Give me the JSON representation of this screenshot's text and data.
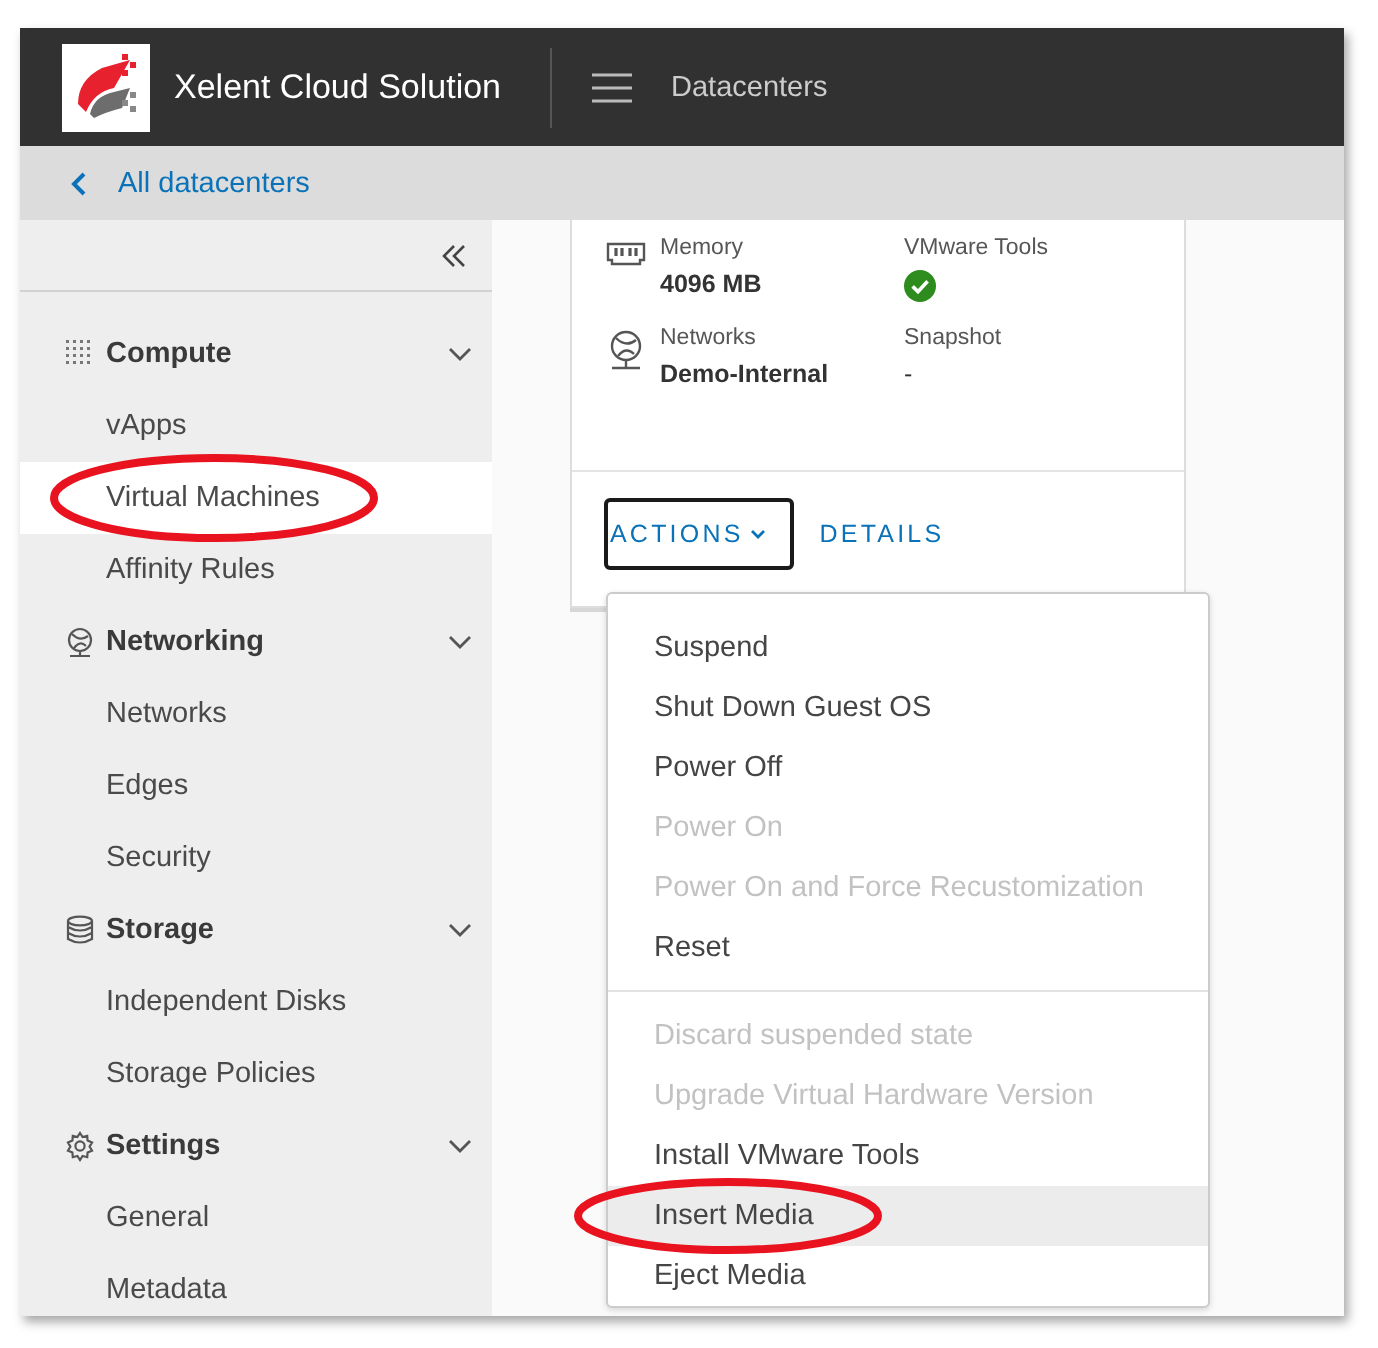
{
  "header": {
    "title": "Xelent Cloud Solution",
    "section": "Datacenters"
  },
  "breadcrumb": {
    "label": "All datacenters"
  },
  "sidebar": {
    "groups": [
      {
        "label": "Compute",
        "expanded": true,
        "items": [
          {
            "label": "vApps",
            "selected": false,
            "circled": false
          },
          {
            "label": "Virtual Machines",
            "selected": true,
            "circled": true
          },
          {
            "label": "Affinity Rules",
            "selected": false,
            "circled": false
          }
        ]
      },
      {
        "label": "Networking",
        "expanded": true,
        "items": [
          {
            "label": "Networks",
            "selected": false,
            "circled": false
          },
          {
            "label": "Edges",
            "selected": false,
            "circled": false
          },
          {
            "label": "Security",
            "selected": false,
            "circled": false
          }
        ]
      },
      {
        "label": "Storage",
        "expanded": true,
        "items": [
          {
            "label": "Independent Disks",
            "selected": false,
            "circled": false
          },
          {
            "label": "Storage Policies",
            "selected": false,
            "circled": false
          }
        ]
      },
      {
        "label": "Settings",
        "expanded": true,
        "items": [
          {
            "label": "General",
            "selected": false,
            "circled": false
          },
          {
            "label": "Metadata",
            "selected": false,
            "circled": false
          }
        ]
      }
    ]
  },
  "vm_card": {
    "properties": [
      {
        "label": "Memory",
        "value": "4096 MB",
        "kind": "text"
      },
      {
        "label": "VMware Tools",
        "kind": "status",
        "ok": true
      },
      {
        "label": "Networks",
        "value": "Demo-Internal",
        "kind": "text"
      },
      {
        "label": "Snapshot",
        "value": "-",
        "kind": "plain"
      }
    ],
    "actions": [
      {
        "label": "ACTIONS",
        "dropdown": true,
        "focused": true
      },
      {
        "label": "DETAILS",
        "dropdown": false,
        "focused": false
      }
    ]
  },
  "actions_menu": {
    "sections": [
      [
        {
          "label": "Suspend",
          "disabled": false,
          "selected": false,
          "circled": false
        },
        {
          "label": "Shut Down Guest OS",
          "disabled": false,
          "selected": false,
          "circled": false
        },
        {
          "label": "Power Off",
          "disabled": false,
          "selected": false,
          "circled": false
        },
        {
          "label": "Power On",
          "disabled": true,
          "selected": false,
          "circled": false
        },
        {
          "label": "Power On and Force Recustomization",
          "disabled": true,
          "selected": false,
          "circled": false
        },
        {
          "label": "Reset",
          "disabled": false,
          "selected": false,
          "circled": false
        }
      ],
      [
        {
          "label": "Discard suspended state",
          "disabled": true,
          "selected": false,
          "circled": false
        },
        {
          "label": "Upgrade Virtual Hardware Version",
          "disabled": true,
          "selected": false,
          "circled": false
        },
        {
          "label": "Install VMware Tools",
          "disabled": false,
          "selected": false,
          "circled": false
        },
        {
          "label": "Insert Media",
          "disabled": false,
          "selected": true,
          "circled": true
        },
        {
          "label": "Eject Media",
          "disabled": false,
          "selected": false,
          "circled": false
        }
      ]
    ]
  }
}
